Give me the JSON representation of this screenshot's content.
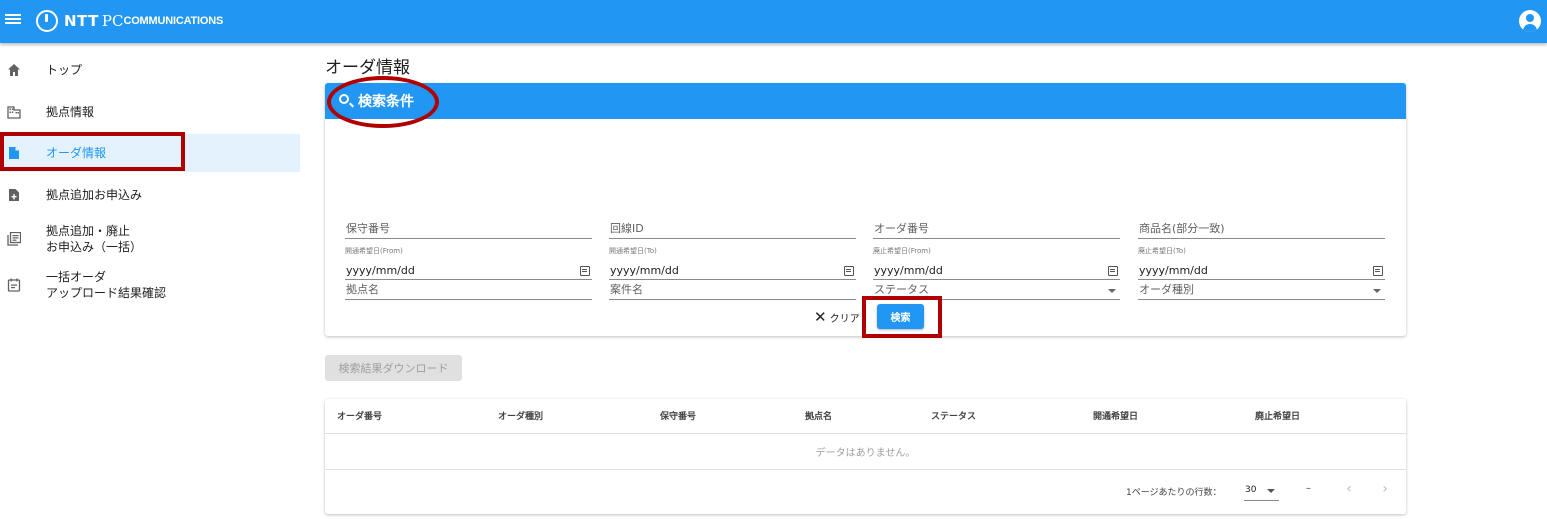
{
  "header": {
    "logo_ntt": "NTT",
    "logo_pc": "PC",
    "logo_communications": "COMMUNICATIONS"
  },
  "sidebar": {
    "items": [
      {
        "label": "トップ",
        "icon": "home-icon"
      },
      {
        "label": "拠点情報",
        "icon": "building-icon"
      },
      {
        "label": "オーダ情報",
        "icon": "document-icon",
        "active": true
      },
      {
        "label": "拠点追加お申込み",
        "icon": "file-add-icon"
      },
      {
        "label_line1": "拠点追加・廃止",
        "label_line2": "お申込み（一括）",
        "icon": "library-books-icon"
      },
      {
        "label_line1": "一括オーダ",
        "label_line2": "アップロード結果確認",
        "icon": "event-note-icon"
      }
    ]
  },
  "page": {
    "title": "オーダ情報"
  },
  "search": {
    "title": "検索条件",
    "row1": [
      "保守番号",
      "回線ID",
      "オーダ番号",
      "商品名(部分一致)"
    ],
    "row2": [
      "拠点名",
      "案件名",
      "ステータス",
      "オーダ種別"
    ],
    "dates": [
      {
        "label": "開通希望日(From)",
        "value": "yyyy/mm/dd"
      },
      {
        "label": "開通希望日(To)",
        "value": "yyyy/mm/dd"
      },
      {
        "label": "廃止希望日(From)",
        "value": "yyyy/mm/dd"
      },
      {
        "label": "廃止希望日(To)",
        "value": "yyyy/mm/dd"
      }
    ],
    "clear_label": "クリア",
    "search_label": "検索"
  },
  "download_label": "検索結果ダウンロード",
  "table": {
    "columns": [
      "オーダ番号",
      "オーダ種別",
      "保守番号",
      "拠点名",
      "ステータス",
      "開通希望日",
      "廃止希望日"
    ],
    "empty_message": "データはありません。",
    "rows_per_page_label": "1ページあたりの行数：",
    "rows_per_page": "30",
    "range": "–"
  },
  "colors": {
    "primary": "#2196f3",
    "highlight": "#b00000",
    "active_bg": "#e3f2fd"
  }
}
